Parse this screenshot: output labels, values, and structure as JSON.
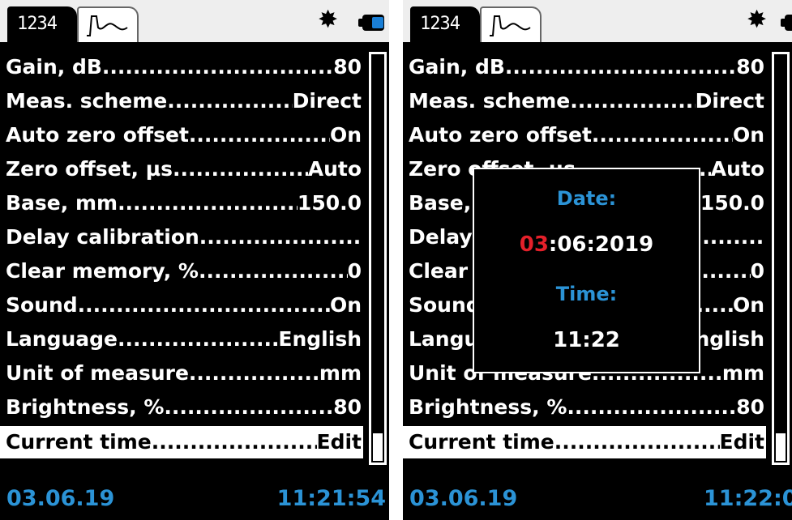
{
  "header": {
    "tab_digits_label": "1234",
    "tab_graph_icon": "waveform-icon",
    "brightness_icon": "sun-icon",
    "battery_icon": "battery-icon"
  },
  "colors": {
    "accent": "#2b93d6",
    "highlight": "#e4202a",
    "background": "#000000"
  },
  "menu": {
    "items": [
      {
        "label": "Gain, dB",
        "value": "80"
      },
      {
        "label": "Meas. scheme",
        "value": "Direct"
      },
      {
        "label": "Auto zero offset",
        "value": "On"
      },
      {
        "label": "Zero offset, µs",
        "value": "Auto"
      },
      {
        "label": "Base, mm",
        "value": "150.0"
      },
      {
        "label": "Delay calibration",
        "value": ""
      },
      {
        "label": "Clear memory, %",
        "value": "0"
      },
      {
        "label": "Sound",
        "value": "On"
      },
      {
        "label": "Language",
        "value": "English"
      },
      {
        "label": "Unit of measure",
        "value": "mm"
      },
      {
        "label": "Brightness, %",
        "value": "80"
      },
      {
        "label": "Current time",
        "value": "Edit"
      }
    ]
  },
  "status_left": {
    "date": "03.06.19",
    "time": "11:21:54"
  },
  "status_right": {
    "date": "03.06.19",
    "time": "11:22:0"
  },
  "dialog": {
    "date_label": "Date:",
    "date_day": "03",
    "date_rest": ":06:2019",
    "time_label": "Time:",
    "time_value": "11:22"
  }
}
